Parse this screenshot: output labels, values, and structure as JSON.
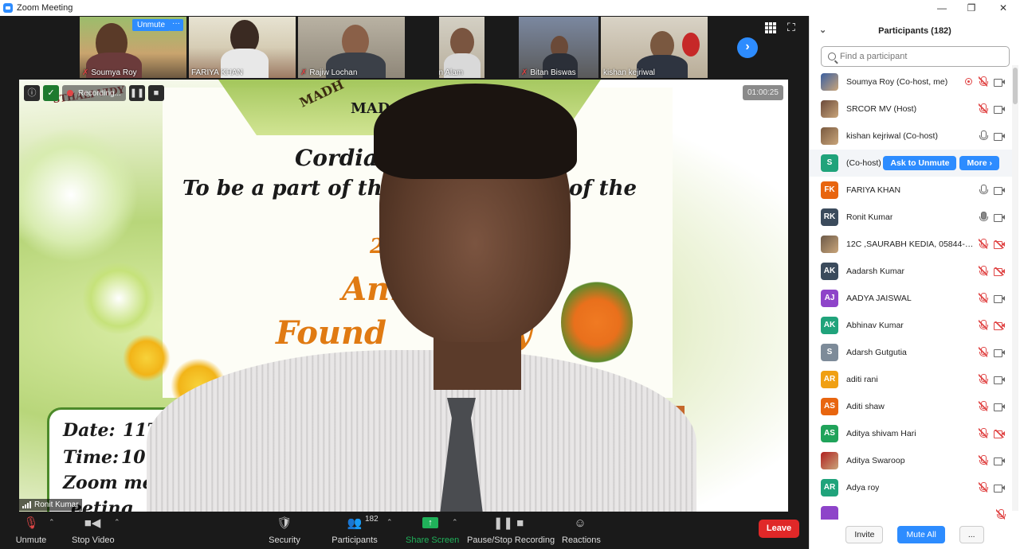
{
  "window": {
    "title": "Zoom Meeting",
    "controls": [
      "minimize-icon",
      "maximize-icon",
      "close-icon"
    ]
  },
  "filmstrip": {
    "unmute_chip": "Unmute",
    "more_chip": "···",
    "tiles": [
      {
        "name": "Soumya Roy",
        "muted": true
      },
      {
        "name": "FARIYA KHAN",
        "muted": false
      },
      {
        "name": "Rajiw Lochan",
        "muted": true
      },
      {
        "name": "Farhan Alam",
        "muted": true
      },
      {
        "name": "Bitan Biswas",
        "muted": true
      },
      {
        "name": "kishan kejriwal",
        "muted": false
      }
    ],
    "next_icon": "chevron-right-icon",
    "grid_icon": "grid-view-icon",
    "fullscreen_icon": "fullscreen-icon"
  },
  "main_video": {
    "speaker_name": "Ronit Kumar",
    "recording_label": "Recording...",
    "timer": "01:00:25",
    "background_text": {
      "institution_arc": "STHALI VIDY",
      "header_arc": "MADH",
      "header_short": "MAD",
      "line1": "Cordiall",
      "line2a": "To be a part of the",
      "line2b": "of the",
      "line3": "2",
      "line4": "Ann",
      "line5a": "Found",
      "line5b": "y",
      "date_label": "Date:",
      "date_value": "11TH Jul",
      "time_label": "Time:",
      "time_value": "10:0",
      "zoom_label": "Zoom mee",
      "meeting_label": "eeting"
    }
  },
  "toolbar": {
    "unmute": "Unmute",
    "stop_video": "Stop Video",
    "security": "Security",
    "participants": "Participants",
    "participants_count": "182",
    "share_screen": "Share Screen",
    "pause_stop_recording": "Pause/Stop Recording",
    "reactions": "Reactions",
    "leave": "Leave"
  },
  "participants_panel": {
    "title": "Participants (182)",
    "search_placeholder": "Find a participant",
    "ask_to_unmute": "Ask to Unmute",
    "more": "More",
    "invite": "Invite",
    "mute_all": "Mute All",
    "more_menu": "...",
    "items": [
      {
        "initials": "",
        "photo": true,
        "name": "Soumya Roy (Co-host, me)",
        "color": "#3a5fa0",
        "mic": "off",
        "cam": "on",
        "recording": true
      },
      {
        "initials": "",
        "photo": true,
        "name": "SRCOR MV (Host)",
        "color": "#6b4a3a",
        "mic": "off",
        "cam": "on"
      },
      {
        "initials": "",
        "photo": true,
        "name": "kishan kejriwal (Co-host)",
        "color": "#7a5a40",
        "mic": "on",
        "cam": "on"
      },
      {
        "initials": "S",
        "photo": false,
        "name": "(Co-host)",
        "color": "#20a37b",
        "mic": "",
        "cam": "",
        "highlight": true
      },
      {
        "initials": "FK",
        "photo": false,
        "name": "FARIYA KHAN",
        "color": "#e8650f",
        "mic": "on",
        "cam": "on"
      },
      {
        "initials": "RK",
        "photo": false,
        "name": "Ronit Kumar",
        "color": "#3b4b5c",
        "mic": "speaking",
        "cam": "on"
      },
      {
        "initials": "",
        "photo": true,
        "name": "12C ,SAURABH KEDIA, 05844-19,...",
        "color": "#6c5a48",
        "mic": "off",
        "cam": "off"
      },
      {
        "initials": "AK",
        "photo": false,
        "name": "Aadarsh Kumar",
        "color": "#3b4b5c",
        "mic": "off",
        "cam": "off"
      },
      {
        "initials": "AJ",
        "photo": false,
        "name": "AADYA JAISWAL",
        "color": "#8e44c9",
        "mic": "off",
        "cam": "on"
      },
      {
        "initials": "AK",
        "photo": false,
        "name": "Abhinav Kumar",
        "color": "#20a37b",
        "mic": "off",
        "cam": "off"
      },
      {
        "initials": "S",
        "photo": false,
        "name": "Adarsh Gutgutia",
        "color": "#7d8b99",
        "mic": "off",
        "cam": "on"
      },
      {
        "initials": "AR",
        "photo": false,
        "name": "aditi rani",
        "color": "#f0a013",
        "mic": "off",
        "cam": "on"
      },
      {
        "initials": "AS",
        "photo": false,
        "name": "Aditi shaw",
        "color": "#e8650f",
        "mic": "off",
        "cam": "on"
      },
      {
        "initials": "AS",
        "photo": false,
        "name": "Aditya shivam Hari",
        "color": "#20a35a",
        "mic": "off",
        "cam": "off"
      },
      {
        "initials": "",
        "photo": true,
        "name": "Aditya Swaroop",
        "color": "#b02020",
        "mic": "off",
        "cam": "on"
      },
      {
        "initials": "AR",
        "photo": false,
        "name": "Adya roy",
        "color": "#20a37b",
        "mic": "off",
        "cam": "on"
      },
      {
        "initials": "",
        "photo": false,
        "name": "",
        "color": "#8e44c9",
        "mic": "off",
        "cam": ""
      }
    ]
  }
}
